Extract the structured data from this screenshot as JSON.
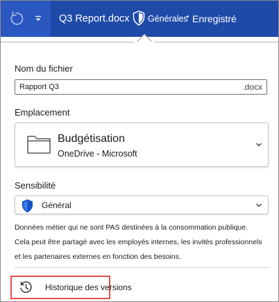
{
  "colors": {
    "titlebar": "#1f4aa8",
    "titlebar_left": "#2a57c0",
    "shield": "#1554c8",
    "highlight": "#e2504a"
  },
  "titlebar": {
    "undo_icon": "undo-icon",
    "qat_icon": "chevron-down-icon",
    "document_title": "Q3 Report.docx",
    "sensitivity_icon": "shield-icon",
    "sensitivity_label": "Générales",
    "sensitivity_dot": "•",
    "save_status": "Enregistré"
  },
  "filename": {
    "label": "Nom du fichier",
    "value": "Rapport Q3",
    "extension": ".docx"
  },
  "location": {
    "label": "Emplacement",
    "icon": "folder-icon",
    "name": "Budgétisation",
    "service": "OneDrive - Microsoft"
  },
  "sensitivity": {
    "label": "Sensibilité",
    "icon": "shield-icon",
    "value": "Général",
    "description_lines": [
      "Données métier qui ne sont PAS destinées à la consommation publique.",
      "Cela peut être partagé avec les employés internes, les invités professionnels",
      "et les partenaires externes en fonction des besoins."
    ]
  },
  "version_history": {
    "icon": "history-icon",
    "label": "Historique des versions"
  }
}
